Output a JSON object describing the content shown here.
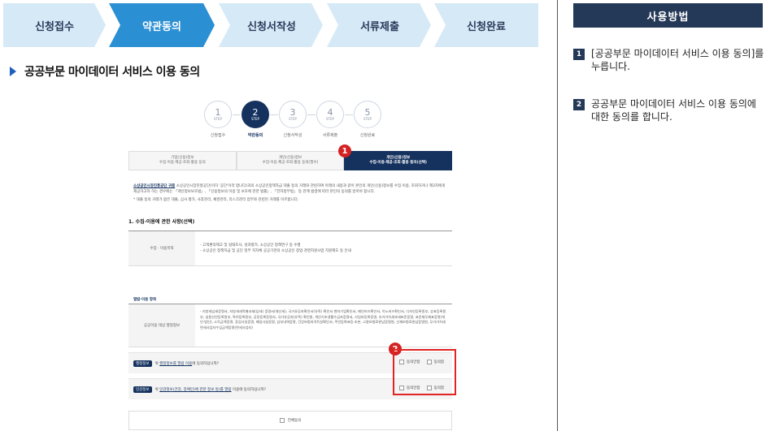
{
  "steps": [
    {
      "label": "신청접수",
      "active": false
    },
    {
      "label": "약관동의",
      "active": true
    },
    {
      "label": "신청서작성",
      "active": false
    },
    {
      "label": "서류제출",
      "active": false
    },
    {
      "label": "신청완료",
      "active": false
    }
  ],
  "colors": {
    "active": "#2a8fd3",
    "inactive": "#d6e9f7",
    "navy": "#15325f",
    "highlight": "#e02424"
  },
  "section_title": "공공부문 마이데이터 서비스 이용 동의",
  "inner": {
    "mini_steps": [
      {
        "num": "1",
        "step": "STEP",
        "label": "신청접수"
      },
      {
        "num": "2",
        "step": "STEP",
        "label": "약관동의"
      },
      {
        "num": "3",
        "step": "STEP",
        "label": "신청서작성"
      },
      {
        "num": "4",
        "step": "STEP",
        "label": "서류제출"
      },
      {
        "num": "5",
        "step": "STEP",
        "label": "신청완료"
      }
    ],
    "subtabs": [
      {
        "line1": "기업(신용)정보",
        "line2": "수집·이용·제공·조회·활용 동의"
      },
      {
        "line1": "개인(신용)정보",
        "line2": "수집·이용·제공·조회·활용 동의[필수]"
      },
      {
        "line1": "개인(신용)정보",
        "line2": "수집·이용·제공·조회·활용 동의(선택)"
      }
    ],
    "badge1": "1",
    "badge2": "2",
    "intro_org": "소상공인시장진흥공단 귀중",
    "intro_text": "소상공인시장진흥공단(이하 '공단'이라 합니다)과의 소상공인정책자금 대출 등의 거래와 관련하여 아래의 내용과 같이 본인의 개인(신용)정보를 수집·이용, 조회하거나 제3자에게 제공하고자 하는 경우에는 「개인정보보호법」, 「신용정보의 이용 및 보호에 관한 법률」, 「전자정부법」 등 관계 법령에 따라 본인의 동의를 받아야 합니다.",
    "intro_note": "* 대출 등의 거래가 없은 대출, 심사 평가, 사후관리, 채권관리, 리스크관리 업무와 관련된 거래를 이르합니다.",
    "sec1_title": "1. 수집·이용에 관한 사항(선택)",
    "purpose_label": "수집 · 이용목적",
    "purpose_lines": [
      "- 고객편의제고 및 실태조사, 성과평가, 소상공인 정책연구 등 수행",
      "- 소상공인 정책자금 및 공단 정부 지자체 공공기관의 소상공인 창업·경영지원사업 지원제도 등 안내"
    ],
    "sub2_title": "열람·이용 항목",
    "system_label": "공공이용 대상 행정정보",
    "system_text": "- 지방세납세증명서, 지방세세목별과세(납세) 증명서(재산세), 국가유공자확인서(유족) 확인서 벤처기업확인서, 메인비즈확인서, 이노비즈확인서, 디자인등록원부, 상표등록원부, 실용신안등록원부, 특허등록원부, 공장등록증명서, 국가유공자(유족) 확인원, 개인기초생활수급자증명서, 사업자등록증명, 부가가치세과세표준증명, 표준재무제표증명(개인·법인), 소득금액증명, 휴업사실증명, 폐업사실증명, 납부내역증명, 건강보험자격득실확인서, 주민등록표등·초본, 고용보험료완납증명원, 산재보험료완납증명원, 무가가치세면세사업자수입금액증명(면세사업자)",
    "q1_tag": "행정정보",
    "q1_pre": "위 ",
    "q1_link": "행정정보를 열람 이용",
    "q1_post": "에 동의하십니까?",
    "q2_tag": "민감정보",
    "q2_pre": "위 ",
    "q2_link": "민감정보(건강, 장애인)에 관한 정보 등)를 열람",
    "q2_post": " 이용에 동의하십니까?",
    "agree": "동의안함",
    "disagree": "동의함",
    "all_agree": "전체동의"
  },
  "usage": {
    "title": "사용방법",
    "items": [
      {
        "num": "1",
        "text": "[공공부문 마이데이터 서비스 이용 동의]를 누릅니다."
      },
      {
        "num": "2",
        "text": "공공부문 마이데이터 서비스 이용 동의에 대한 동의를 합니다."
      }
    ]
  }
}
